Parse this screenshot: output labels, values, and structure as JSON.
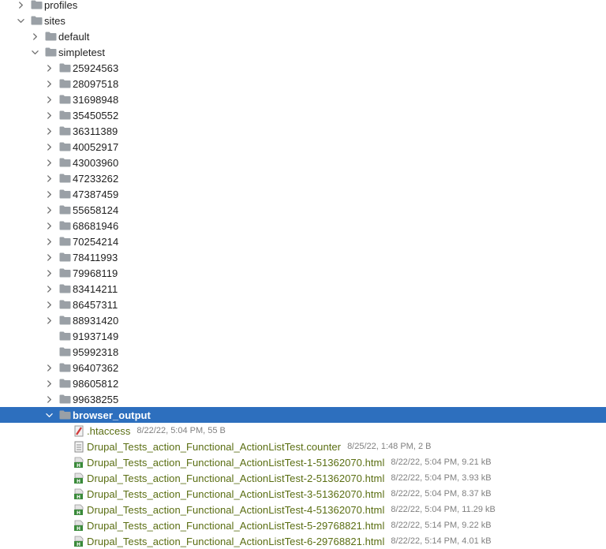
{
  "colors": {
    "selection": "#2d6fbe",
    "folder": "#9aa0a6",
    "file_text": "#5a6e12",
    "meta_text": "#808080"
  },
  "tree": [
    {
      "label": "profiles",
      "level": 1,
      "state": "collapsed",
      "icon": "folder-icon"
    },
    {
      "label": "sites",
      "level": 1,
      "state": "expanded",
      "icon": "folder-icon"
    },
    {
      "label": "default",
      "level": 2,
      "state": "collapsed",
      "icon": "folder-icon"
    },
    {
      "label": "simpletest",
      "level": 2,
      "state": "expanded",
      "icon": "folder-icon"
    },
    {
      "label": "25924563",
      "level": 3,
      "state": "collapsed",
      "icon": "folder-icon"
    },
    {
      "label": "28097518",
      "level": 3,
      "state": "collapsed",
      "icon": "folder-icon"
    },
    {
      "label": "31698948",
      "level": 3,
      "state": "collapsed",
      "icon": "folder-icon"
    },
    {
      "label": "35450552",
      "level": 3,
      "state": "collapsed",
      "icon": "folder-icon"
    },
    {
      "label": "36311389",
      "level": 3,
      "state": "collapsed",
      "icon": "folder-icon"
    },
    {
      "label": "40052917",
      "level": 3,
      "state": "collapsed",
      "icon": "folder-icon"
    },
    {
      "label": "43003960",
      "level": 3,
      "state": "collapsed",
      "icon": "folder-icon"
    },
    {
      "label": "47233262",
      "level": 3,
      "state": "collapsed",
      "icon": "folder-icon"
    },
    {
      "label": "47387459",
      "level": 3,
      "state": "collapsed",
      "icon": "folder-icon"
    },
    {
      "label": "55658124",
      "level": 3,
      "state": "collapsed",
      "icon": "folder-icon"
    },
    {
      "label": "68681946",
      "level": 3,
      "state": "collapsed",
      "icon": "folder-icon"
    },
    {
      "label": "70254214",
      "level": 3,
      "state": "collapsed",
      "icon": "folder-icon"
    },
    {
      "label": "78411993",
      "level": 3,
      "state": "collapsed",
      "icon": "folder-icon"
    },
    {
      "label": "79968119",
      "level": 3,
      "state": "collapsed",
      "icon": "folder-icon"
    },
    {
      "label": "83414211",
      "level": 3,
      "state": "collapsed",
      "icon": "folder-icon"
    },
    {
      "label": "86457311",
      "level": 3,
      "state": "collapsed",
      "icon": "folder-icon"
    },
    {
      "label": "88931420",
      "level": 3,
      "state": "collapsed",
      "icon": "folder-icon"
    },
    {
      "label": "91937149",
      "level": 3,
      "state": "none",
      "icon": "folder-icon"
    },
    {
      "label": "95992318",
      "level": 3,
      "state": "none",
      "icon": "folder-icon"
    },
    {
      "label": "96407362",
      "level": 3,
      "state": "collapsed",
      "icon": "folder-icon"
    },
    {
      "label": "98605812",
      "level": 3,
      "state": "collapsed",
      "icon": "folder-icon"
    },
    {
      "label": "99638255",
      "level": 3,
      "state": "collapsed",
      "icon": "folder-icon"
    },
    {
      "label": "browser_output",
      "level": 3,
      "state": "expanded",
      "icon": "folder-icon",
      "selected": true
    },
    {
      "label": ".htaccess",
      "level": 4,
      "state": "none",
      "icon": "htaccess-file-icon",
      "file": true,
      "meta": "8/22/22, 5:04 PM, 55 B"
    },
    {
      "label": "Drupal_Tests_action_Functional_ActionListTest.counter",
      "level": 4,
      "state": "none",
      "icon": "text-file-icon",
      "file": true,
      "meta": "8/25/22, 1:48 PM, 2 B"
    },
    {
      "label": "Drupal_Tests_action_Functional_ActionListTest-1-51362070.html",
      "level": 4,
      "state": "none",
      "icon": "html-file-icon",
      "file": true,
      "meta": "8/22/22, 5:04 PM, 9.21 kB"
    },
    {
      "label": "Drupal_Tests_action_Functional_ActionListTest-2-51362070.html",
      "level": 4,
      "state": "none",
      "icon": "html-file-icon",
      "file": true,
      "meta": "8/22/22, 5:04 PM, 3.93 kB"
    },
    {
      "label": "Drupal_Tests_action_Functional_ActionListTest-3-51362070.html",
      "level": 4,
      "state": "none",
      "icon": "html-file-icon",
      "file": true,
      "meta": "8/22/22, 5:04 PM, 8.37 kB"
    },
    {
      "label": "Drupal_Tests_action_Functional_ActionListTest-4-51362070.html",
      "level": 4,
      "state": "none",
      "icon": "html-file-icon",
      "file": true,
      "meta": "8/22/22, 5:04 PM, 11.29 kB"
    },
    {
      "label": "Drupal_Tests_action_Functional_ActionListTest-5-29768821.html",
      "level": 4,
      "state": "none",
      "icon": "html-file-icon",
      "file": true,
      "meta": "8/22/22, 5:14 PM, 9.22 kB"
    },
    {
      "label": "Drupal_Tests_action_Functional_ActionListTest-6-29768821.html",
      "level": 4,
      "state": "none",
      "icon": "html-file-icon",
      "file": true,
      "meta": "8/22/22, 5:14 PM, 4.01 kB"
    }
  ]
}
